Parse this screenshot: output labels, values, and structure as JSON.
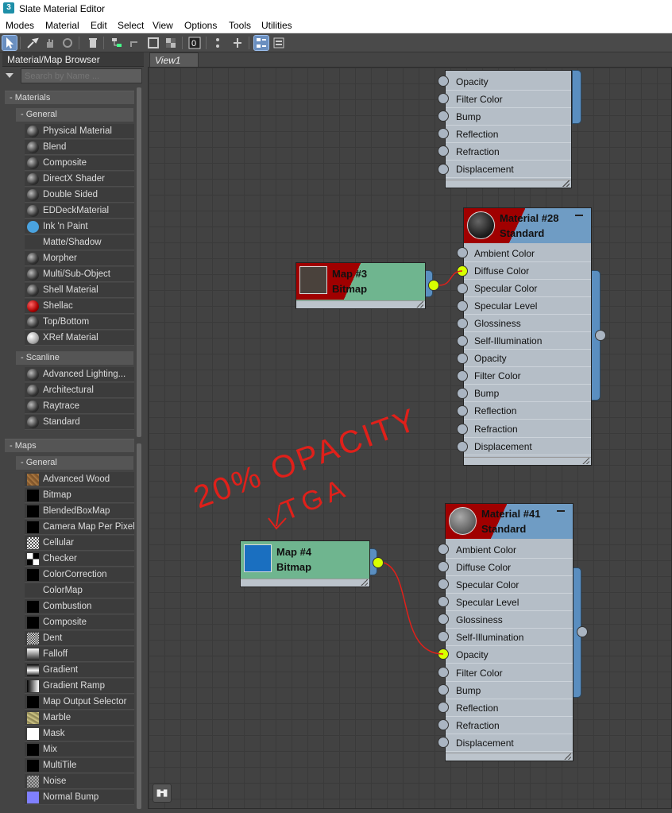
{
  "window": {
    "title": "Slate Material Editor",
    "app_icon": "3"
  },
  "menu": [
    "Modes",
    "Material",
    "Edit",
    "Select",
    "View",
    "Options",
    "Tools",
    "Utilities"
  ],
  "toolbar": {
    "icons": [
      "select-arrow-icon",
      "eyedropper-icon",
      "hand-icon",
      "delete-icon",
      "layout-icon",
      "move-children-icon",
      "show-shaded-icon",
      "background-icon",
      "material-id-icon",
      "show-map-icon",
      "show-end-result-icon",
      "layout-all-icon",
      "layout-children-icon",
      "params-icon",
      "browser-icon"
    ]
  },
  "browser": {
    "title": "Material/Map Browser",
    "search_placeholder": "Search by Name ...",
    "materials_label": "- Materials",
    "general_label": "- General",
    "general_items": [
      "Physical Material",
      "Blend",
      "Composite",
      "DirectX Shader",
      "Double Sided",
      "EDDeckMaterial",
      "Ink 'n Paint",
      "Matte/Shadow",
      "Morpher",
      "Multi/Sub-Object",
      "Shell Material",
      "Shellac",
      "Top/Bottom",
      "XRef Material"
    ],
    "scanline_label": "- Scanline",
    "scanline_items": [
      "Advanced Lighting...",
      "Architectural",
      "Raytrace",
      "Standard"
    ],
    "maps_label": "- Maps",
    "maps_general_label": "- General",
    "maps_items": [
      "Advanced Wood",
      "Bitmap",
      "BlendedBoxMap",
      "Camera Map Per Pixel",
      "Cellular",
      "Checker",
      "ColorCorrection",
      "ColorMap",
      "Combustion",
      "Composite",
      "Dent",
      "Falloff",
      "Gradient",
      "Gradient Ramp",
      "Map Output Selector",
      "Marble",
      "Mask",
      "Mix",
      "MultiTile",
      "Noise",
      "Normal Bump"
    ]
  },
  "view": {
    "tab": "View1"
  },
  "top_node": {
    "slots": [
      "Opacity",
      "Filter Color",
      "Bump",
      "Reflection",
      "Refraction",
      "Displacement"
    ]
  },
  "material_28": {
    "name": "Material #28",
    "type": "Standard",
    "slots": [
      "Ambient Color",
      "Diffuse Color",
      "Specular Color",
      "Specular Level",
      "Glossiness",
      "Self-Illumination",
      "Opacity",
      "Filter Color",
      "Bump",
      "Reflection",
      "Refraction",
      "Displacement"
    ],
    "connected_slot": "Diffuse Color"
  },
  "map_3": {
    "name": "Map #3",
    "type": "Bitmap",
    "thumb_color": "#4a423c"
  },
  "material_41": {
    "name": "Material #41",
    "type": "Standard",
    "slots": [
      "Ambient Color",
      "Diffuse Color",
      "Specular Color",
      "Specular Level",
      "Glossiness",
      "Self-Illumination",
      "Opacity",
      "Filter Color",
      "Bump",
      "Reflection",
      "Refraction",
      "Displacement"
    ],
    "connected_slot": "Opacity"
  },
  "map_4": {
    "name": "Map #4",
    "type": "Bitmap",
    "thumb_color": "#1a6fc0"
  },
  "annotation": {
    "text_line1": "20% OPACITY",
    "text_line2": "TGA",
    "color": "#e0201a"
  },
  "colors": {
    "wire": "#e0201a",
    "pin_active": "#d8ff00",
    "header_blue": "#6f9cc4",
    "map_green": "#6fb58f"
  }
}
